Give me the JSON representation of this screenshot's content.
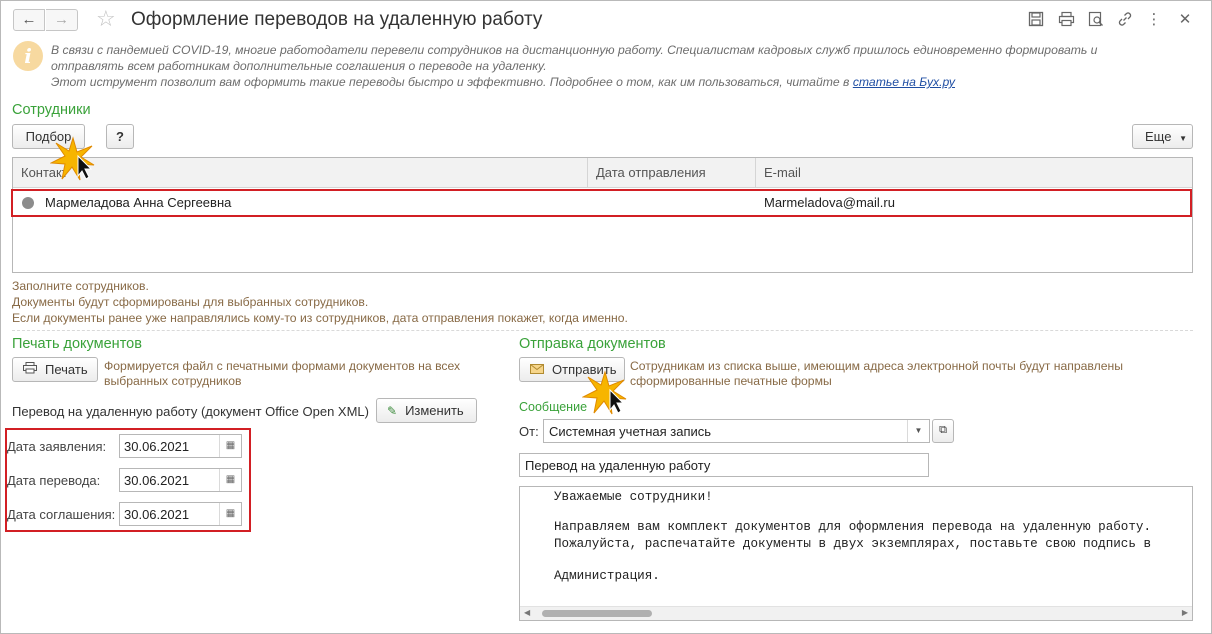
{
  "window": {
    "title": "Оформление переводов на удаленную работу"
  },
  "info": {
    "line1": "В связи с пандемией COVID-19, многие работодатели перевели сотрудников на дистанционную работу. Специалистам кадровых служб пришлось единовременно формировать и",
    "line2": "отправлять всем работникам дополнительные соглашения о переводе на удаленку.",
    "line3": "Этот иструмент позволит вам оформить такие переводы быстро и эффективно. Подробнее о том, как им пользоваться, читайте в ",
    "link": "статье на Бух.ру"
  },
  "employees": {
    "title": "Сотрудники",
    "pick_label": "Подбор",
    "help_label": "?",
    "more_label": "Еще",
    "columns": [
      "Контакт",
      "Дата отправления",
      "E-mail"
    ],
    "rows": [
      {
        "contact": "Мармеладова Анна Сергеевна",
        "date": "",
        "email": "Marmeladova@mail.ru"
      }
    ],
    "hints": [
      "Заполните сотрудников.",
      "Документы будут сформированы для выбранных сотрудников.",
      "Если документы ранее уже направлялись кому-то из сотрудников, дата отправления покажет, когда именно."
    ]
  },
  "print": {
    "title": "Печать документов",
    "button_label": "Печать",
    "note_line1": "Формируется файл с печатными формами документов на всех",
    "note_line2": "выбранных сотрудников",
    "doc_label": "Перевод на удаленную работу (документ Office Open XML)",
    "edit_label": "Изменить",
    "dates": [
      {
        "label": "Дата заявления:",
        "value": "30.06.2021"
      },
      {
        "label": "Дата перевода:",
        "value": "30.06.2021"
      },
      {
        "label": "Дата соглашения:",
        "value": "30.06.2021"
      }
    ]
  },
  "send": {
    "title": "Отправка документов",
    "button_label": "Отправить",
    "note_line1": "Сотрудникам из списка выше, имеющим адреса электронной почты будут направлены",
    "note_line2": "сформированные печатные формы",
    "message_label": "Сообщение",
    "from_label": "От:",
    "from_value": "Системная учетная запись",
    "subject": "Перевод на удаленную работу",
    "body": {
      "greeting": "Уважаемые сотрудники!",
      "line1": "Направляем вам комплект документов для оформления перевода на удаленную работу.",
      "line2": "Пожалуйста, распечатайте документы в двух экземплярах, поставьте свою подпись в",
      "signature": "Администрация."
    }
  },
  "colors": {
    "accent_green": "#3aa23a",
    "highlight_red": "#d21f24",
    "hint_brown": "#886a46"
  }
}
